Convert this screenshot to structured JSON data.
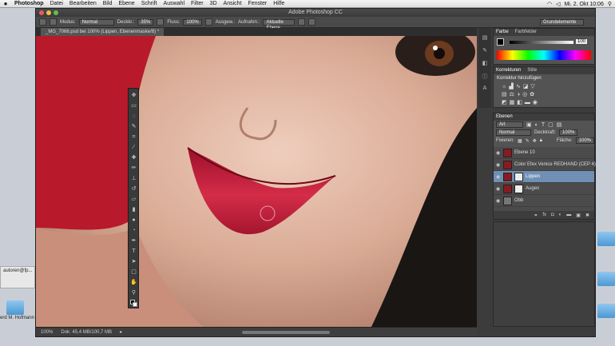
{
  "menubar": {
    "app": "Photoshop",
    "items": [
      "Datei",
      "Bearbeiten",
      "Bild",
      "Ebene",
      "Schrift",
      "Auswahl",
      "Filter",
      "3D",
      "Ansicht",
      "Fenster",
      "Hilfe"
    ],
    "clock": "Mi. 2. Okt 10:06"
  },
  "window": {
    "title": "Adobe Photoshop CC",
    "doc_tab": "_MG_7066.psd bei 100% (Lippen, Ebenenmaske/8) *",
    "workspace": "Grundelemente"
  },
  "options": {
    "modus_label": "Modus:",
    "modus_value": "Normal",
    "deckkraft_label": "Deckkr.:",
    "deckkraft_value": "35%",
    "fluss_label": "Fluss:",
    "fluss_value": "100%",
    "ausgewahlt_label": "Ausgew.:",
    "aufnahme_label": "Aufnahm.:",
    "aufnahme_value": "Aktuelle Ebene"
  },
  "status": {
    "zoom": "100%",
    "doc": "Dok: 45,4 MB/100,7 MB"
  },
  "farbe_panel": {
    "tabs": [
      "Farbe",
      "Farbfelder"
    ],
    "value": "100"
  },
  "korrekturen_panel": {
    "tabs": [
      "Korrekturen",
      "Stile"
    ],
    "title": "Korrektur hinzufügen"
  },
  "ebenen_panel": {
    "tab": "Ebenen",
    "filter": "Art",
    "blend_mode": "Normal",
    "opacity_label": "Deckkraft:",
    "opacity_value": "100%",
    "lock_label": "Fixieren:",
    "fill_label": "Fläche:",
    "fill_value": "100%",
    "layers": [
      {
        "name": "Ebene 10",
        "selected": false,
        "mask": false
      },
      {
        "name": "Color Efex Venice REDHAND (CEP 4)",
        "selected": false,
        "mask": false
      },
      {
        "name": "Lippen",
        "selected": true,
        "mask": true
      },
      {
        "name": "Augen",
        "selected": false,
        "mask": true
      },
      {
        "name": "Obb",
        "selected": false,
        "mask": false
      }
    ]
  },
  "desktop": {
    "labels": [
      "erd M. Hofmann",
      "autoren@fp..."
    ]
  },
  "colors": {
    "lip": "#c2203d",
    "skin": "#d9ab95",
    "selection": "#6f8fb4",
    "panel": "#535353"
  }
}
